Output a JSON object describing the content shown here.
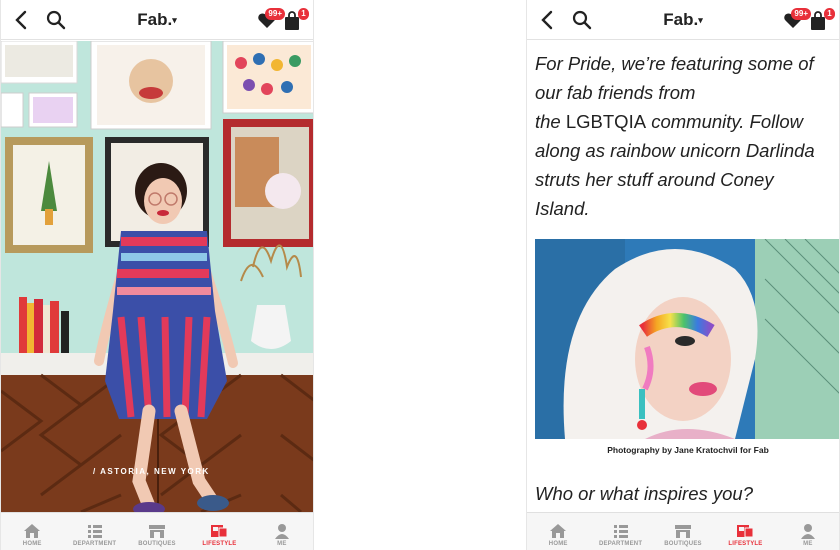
{
  "top_bar": {
    "logo": "Fab.",
    "logo_caret": "▾",
    "wishlist_badge": "99+",
    "cart_badge": "1"
  },
  "bottom_nav": [
    {
      "label": "HOME",
      "icon": "home-icon"
    },
    {
      "label": "DEPARTMENT",
      "icon": "list-icon"
    },
    {
      "label": "BOUTIQUES",
      "icon": "store-icon"
    },
    {
      "label": "LIFESTYLE",
      "icon": "lifestyle-icon",
      "active": true
    },
    {
      "label": "ME",
      "icon": "person-icon"
    }
  ],
  "left_screen": {
    "photo_caption": "/  ASTORIA, NEW YORK"
  },
  "right_screen": {
    "intro_line1": "For Pride, we’re featuring some of",
    "intro_line2": "our fab friends from",
    "intro_line3_prefix": "the ",
    "intro_line3_acronym": "LGBTQIA",
    "intro_line3_suffix": " community. Follow",
    "intro_line4": "along as rainbow unicorn Darlinda",
    "intro_line5": "struts her stuff around Coney",
    "intro_line6": "Island.",
    "photo_credit": "Photography by Jane Kratochvil for Fab",
    "question": "Who or what inspires you?"
  },
  "colors": {
    "accent": "#e8303a",
    "nav_inactive": "#999999",
    "wall_mint": "#bfe6dc",
    "wood": "#7a3a1c"
  }
}
